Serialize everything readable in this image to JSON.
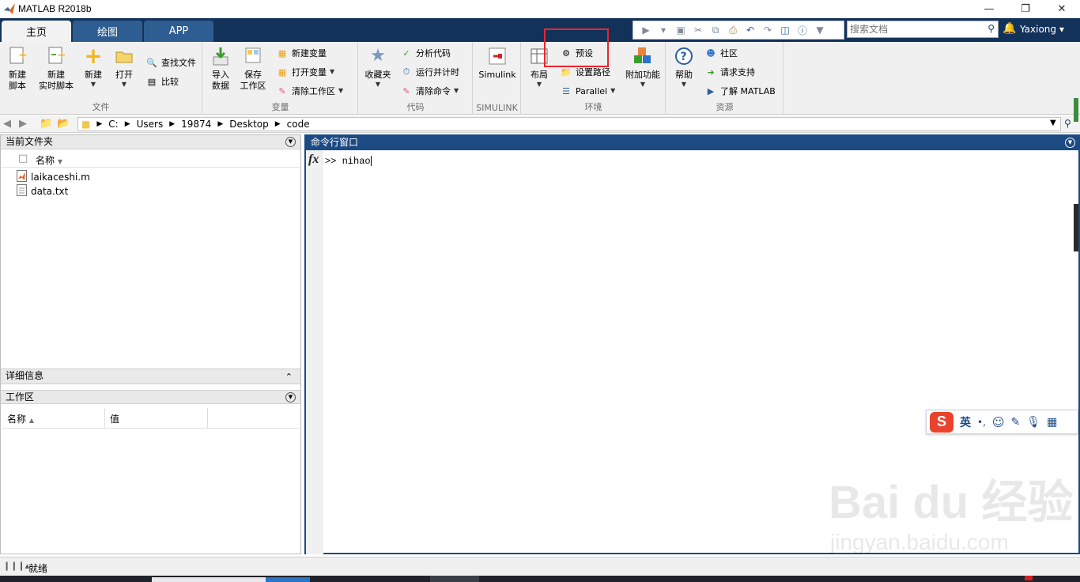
{
  "window": {
    "title": "MATLAB R2018b"
  },
  "tabs": [
    {
      "label": "主页",
      "active": true
    },
    {
      "label": "绘图"
    },
    {
      "label": "APP"
    }
  ],
  "search": {
    "placeholder": "搜索文档"
  },
  "user": {
    "name": "Yaxiong"
  },
  "ribbon": {
    "file": {
      "title": "文件",
      "new_script": "新建\n脚本",
      "new_live": "新建\n实时脚本",
      "new": "新建",
      "open": "打开",
      "find_files": "查找文件",
      "compare": "比较"
    },
    "variable": {
      "title": "变量",
      "import": "导入\n数据",
      "save_ws": "保存\n工作区",
      "new_var": "新建变量",
      "open_var": "打开变量",
      "clear_ws": "清除工作区"
    },
    "code": {
      "title": "代码",
      "favorites": "收藏夹",
      "analyze": "分析代码",
      "run_time": "运行并计时",
      "clear_cmd": "清除命令"
    },
    "simulink": {
      "title": "SIMULINK",
      "label": "Simulink"
    },
    "env": {
      "title": "环境",
      "layout": "布局",
      "prefs": "预设",
      "set_path": "设置路径",
      "parallel": "Parallel",
      "addons": "附加功能"
    },
    "resources": {
      "title": "资源",
      "help": "帮助",
      "community": "社区",
      "support": "请求支持",
      "learn": "了解 MATLAB"
    }
  },
  "address": {
    "segments": [
      "C:",
      "Users",
      "19874",
      "Desktop",
      "code"
    ]
  },
  "current_folder": {
    "title": "当前文件夹",
    "name_header": "名称",
    "files": [
      {
        "name": "laikaceshi.m",
        "icon": "mfile-icon"
      },
      {
        "name": "data.txt",
        "icon": "text-file-icon"
      }
    ]
  },
  "details": {
    "title": "详细信息"
  },
  "workspace": {
    "title": "工作区",
    "col_name": "名称",
    "col_value": "值"
  },
  "command_window": {
    "title": "命令行窗口",
    "prompt": ">>",
    "input": "nihao"
  },
  "status": {
    "text": "就绪"
  },
  "ime": {
    "lang": "英",
    "punct": "•,"
  },
  "watermark": {
    "logo": "Bai du 经验",
    "url": "jingyan.baidu.com"
  },
  "colors": {
    "tabbar": "#13325a",
    "accent": "#1c4a83",
    "highlight": "#e8262c"
  }
}
